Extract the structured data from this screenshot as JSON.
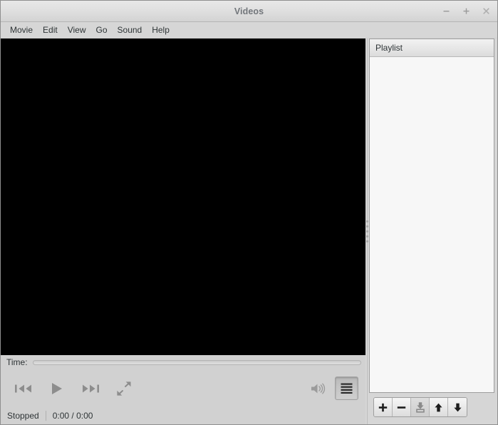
{
  "window": {
    "title": "Videos",
    "controls": [
      {
        "name": "minimize",
        "glyph": "−"
      },
      {
        "name": "maximize",
        "glyph": "+"
      },
      {
        "name": "close",
        "glyph": "×"
      }
    ]
  },
  "menubar": {
    "items": [
      {
        "label": "Movie"
      },
      {
        "label": "Edit"
      },
      {
        "label": "View"
      },
      {
        "label": "Go"
      },
      {
        "label": "Sound"
      },
      {
        "label": "Help"
      }
    ]
  },
  "video": {
    "background_color": "#000000",
    "content": ""
  },
  "controls": {
    "time_label": "Time:",
    "seek_value": 0,
    "seek_min": 0,
    "seek_max": 100,
    "transport": [
      {
        "name": "previous",
        "icon": "previous-icon",
        "enabled": false
      },
      {
        "name": "play",
        "icon": "play-icon",
        "enabled": false
      },
      {
        "name": "next",
        "icon": "next-icon",
        "enabled": false
      },
      {
        "name": "fullscreen",
        "icon": "fullscreen-icon",
        "enabled": false
      }
    ],
    "volume": {
      "icon": "volume-icon",
      "enabled": false
    },
    "playlist_toggle": {
      "icon": "hamburger-icon",
      "pressed": true
    }
  },
  "statusbar": {
    "state": "Stopped",
    "time": "0:00 / 0:00"
  },
  "playlist": {
    "header": "Playlist",
    "items": [],
    "toolbar": [
      {
        "name": "add",
        "icon": "plus-icon",
        "enabled": true
      },
      {
        "name": "remove",
        "icon": "minus-icon",
        "enabled": true
      },
      {
        "name": "save",
        "icon": "save-disk-icon",
        "enabled": false
      },
      {
        "name": "move-up",
        "icon": "arrow-up-icon",
        "enabled": true
      },
      {
        "name": "move-down",
        "icon": "arrow-down-icon",
        "enabled": true
      }
    ]
  },
  "colors": {
    "chrome": "#d6d6d6",
    "video": "#000000",
    "title_text": "#72767b",
    "body_text": "#2e3436",
    "icon_disabled": "#8d8d8d",
    "panel": "#f7f7f7"
  }
}
